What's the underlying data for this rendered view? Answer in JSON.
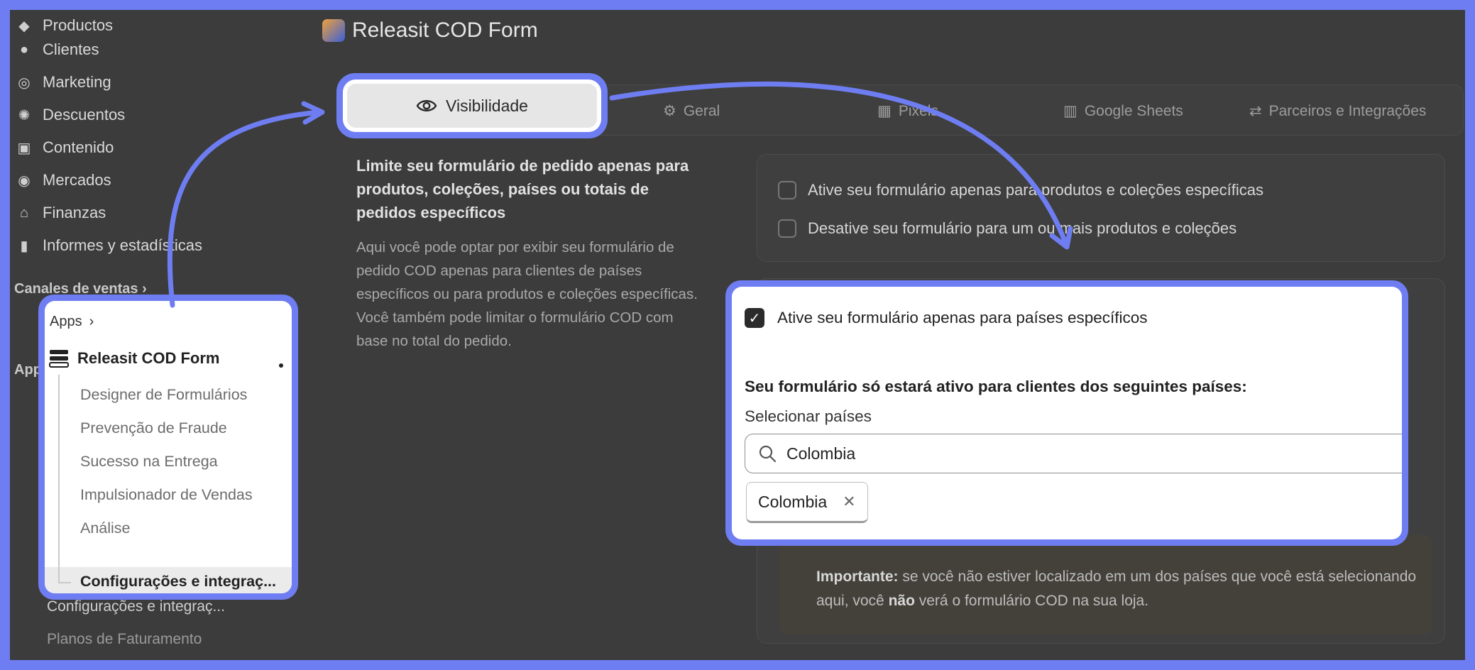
{
  "sidebar": {
    "items": [
      {
        "label": "Productos",
        "icon": "tag-icon"
      },
      {
        "label": "Clientes",
        "icon": "person-icon"
      },
      {
        "label": "Marketing",
        "icon": "target-icon"
      },
      {
        "label": "Descuentos",
        "icon": "discount-icon"
      },
      {
        "label": "Contenido",
        "icon": "image-icon"
      },
      {
        "label": "Mercados",
        "icon": "globe-icon"
      },
      {
        "label": "Finanzas",
        "icon": "bank-icon"
      },
      {
        "label": "Informes y estadísticas",
        "icon": "bar-chart-icon"
      }
    ],
    "channels_label": "Canales de ventas",
    "apps_label": "Apps",
    "dim_selected": "Configurações e integraç...",
    "billing": "Planos de Faturamento"
  },
  "header": {
    "title": "Releasit COD Form"
  },
  "tabs": [
    {
      "label": "Visibilidade",
      "icon": "eye-icon"
    },
    {
      "label": "Geral",
      "icon": "gear-icon"
    },
    {
      "label": "Pixels",
      "icon": "pixels-icon"
    },
    {
      "label": "Google Sheets",
      "icon": "sheets-icon"
    },
    {
      "label": "Parceiros e Integrações",
      "icon": "sync-icon"
    }
  ],
  "description": {
    "title": "Limite seu formulário de pedido apenas para produtos, coleções, países ou totais de pedidos específicos",
    "body": "Aqui você pode optar por exibir seu formulário de pedido COD apenas para clientes de países específicos ou para produtos e coleções específicas. Você também pode limitar o formulário COD com base no total do pedido."
  },
  "product_options": {
    "enable_specific": "Ative seu formulário apenas para produtos e coleções específicas",
    "disable_specific": "Desative seu formulário para um ou mais produtos e coleções"
  },
  "warning": {
    "bold": "Importante:",
    "text1": " se você não estiver localizado em um dos países que você está selecionando aqui, você ",
    "bold2": "não",
    "text2": " verá o formulário COD na sua loja."
  },
  "nav_popout": {
    "apps": "Apps",
    "app_name": "Releasit COD Form",
    "items": [
      "Designer de Formulários",
      "Prevenção de Fraude",
      "Sucesso na Entrega",
      "Impulsionador de Vendas",
      "Análise"
    ],
    "selected": "Configurações e integraç..."
  },
  "form_popout": {
    "checkbox_label": "Ative seu formulário apenas para países específicos",
    "checked": true,
    "question": "Seu formulário só estará ativo para clientes dos seguintes países:",
    "select_label": "Selecionar países",
    "search_value": "Colombia",
    "selected_tags": [
      "Colombia"
    ]
  },
  "colors": {
    "accent": "#6e7ef2",
    "dim_bg": "#3c3c3c"
  }
}
